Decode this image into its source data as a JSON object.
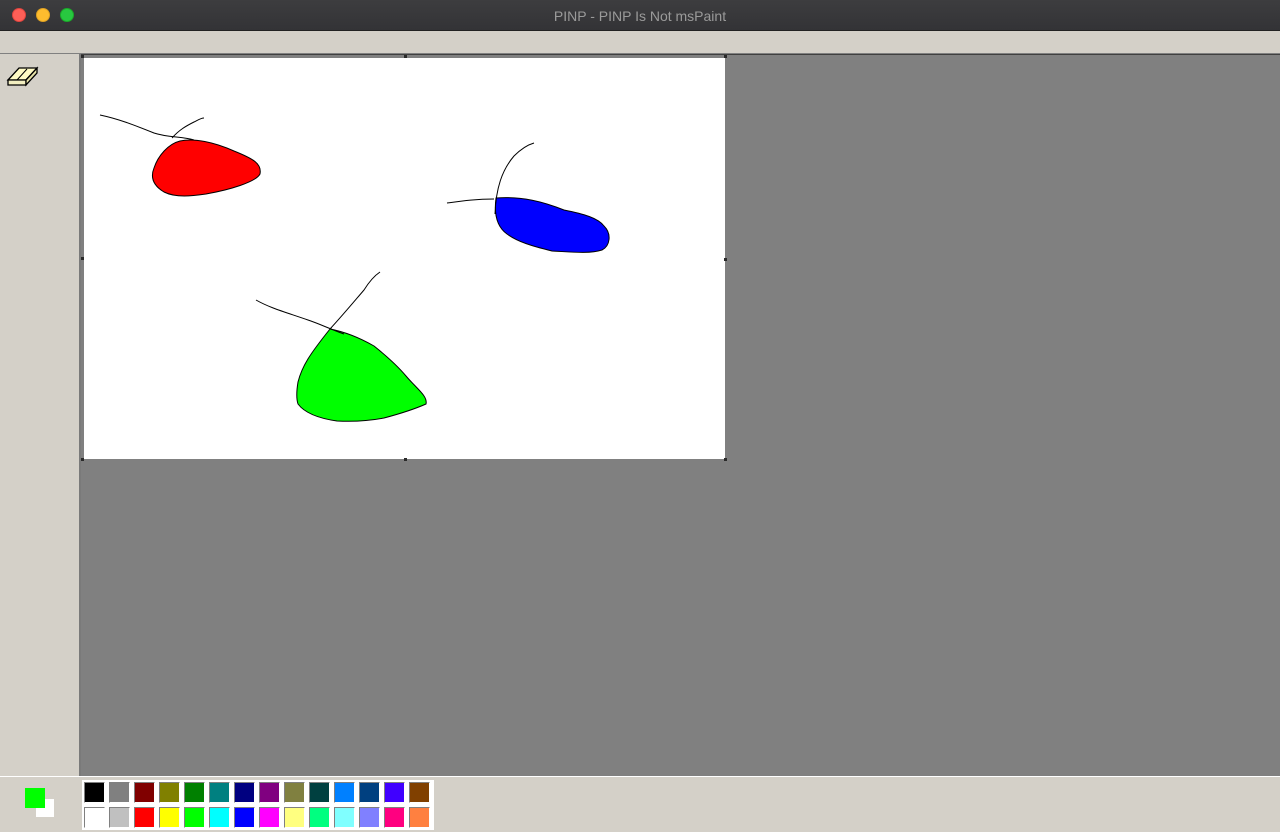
{
  "window": {
    "title": "PINP - PINP Is Not msPaint"
  },
  "toolbox": {
    "tools": [
      {
        "icon": "eraser-icon"
      }
    ]
  },
  "current_colors": {
    "foreground": "#00ff00",
    "background": "#ffffff"
  },
  "palette": {
    "row1": [
      "#000000",
      "#808080",
      "#800000",
      "#808000",
      "#008000",
      "#008080",
      "#000080",
      "#800080",
      "#808040",
      "#004040",
      "#0080ff",
      "#004080",
      "#4000ff",
      "#804000"
    ],
    "row2": [
      "#ffffff",
      "#c0c0c0",
      "#ff0000",
      "#ffff00",
      "#00ff00",
      "#00ffff",
      "#0000ff",
      "#ff00ff",
      "#ffff80",
      "#00ff80",
      "#80ffff",
      "#8080ff",
      "#ff0080",
      "#ff8040"
    ]
  },
  "drawing": {
    "shapes": [
      {
        "name": "red-blob",
        "fill": "#ff0000"
      },
      {
        "name": "blue-blob",
        "fill": "#0000ff"
      },
      {
        "name": "green-blob",
        "fill": "#00ff00"
      }
    ],
    "stroke_color": "#000000"
  }
}
